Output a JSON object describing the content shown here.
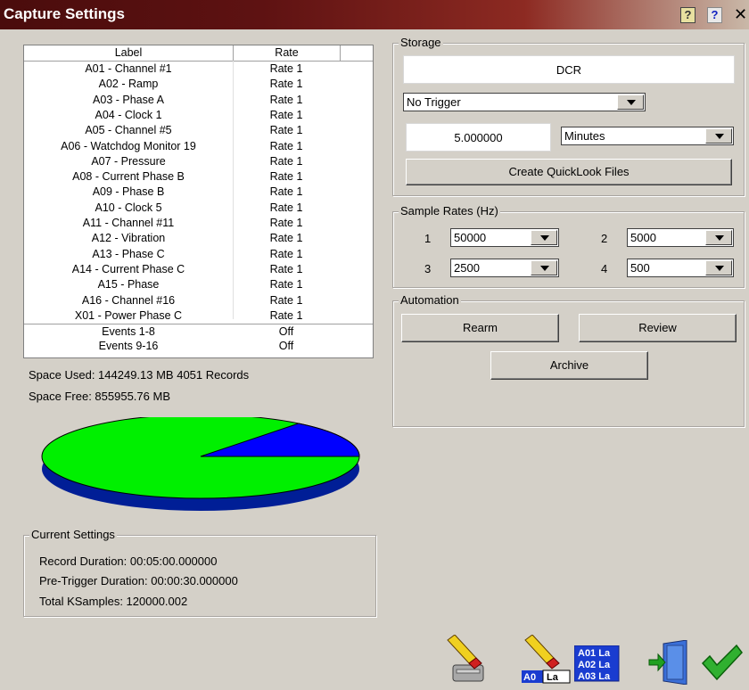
{
  "window": {
    "title": "Capture Settings",
    "help_label": "?",
    "close_label": "✕"
  },
  "channels": {
    "headers": [
      "Label",
      "Rate"
    ],
    "rows": [
      {
        "label": "A01 - Channel #1",
        "rate": "Rate 1"
      },
      {
        "label": "A02 - Ramp",
        "rate": "Rate 1"
      },
      {
        "label": "A03 - Phase A",
        "rate": "Rate 1"
      },
      {
        "label": "A04 - Clock 1",
        "rate": "Rate 1"
      },
      {
        "label": "A05 - Channel #5",
        "rate": "Rate 1"
      },
      {
        "label": "A06 - Watchdog Monitor 19",
        "rate": "Rate 1"
      },
      {
        "label": "A07 - Pressure",
        "rate": "Rate 1"
      },
      {
        "label": "A08 - Current Phase B",
        "rate": "Rate 1"
      },
      {
        "label": "A09 - Phase B",
        "rate": "Rate 1"
      },
      {
        "label": "A10 - Clock 5",
        "rate": "Rate 1"
      },
      {
        "label": "A11 - Channel #11",
        "rate": "Rate 1"
      },
      {
        "label": "A12 - Vibration",
        "rate": "Rate 1"
      },
      {
        "label": "A13 - Phase C",
        "rate": "Rate 1"
      },
      {
        "label": "A14 - Current Phase C",
        "rate": "Rate 1"
      },
      {
        "label": "A15 - Phase",
        "rate": "Rate 1"
      },
      {
        "label": "A16 - Channel #16",
        "rate": "Rate 1"
      },
      {
        "label": "X01 - Power Phase C",
        "rate": "Rate 1"
      },
      {
        "label": "Events 1-8",
        "rate": "Off"
      },
      {
        "label": "Events 9-16",
        "rate": "Off"
      }
    ]
  },
  "space": {
    "used": "Space Used: 144249.13 MB  4051 Records",
    "free": "Space Free: 855955.76 MB",
    "used_fraction": 0.1442,
    "used_color": "#0000ff",
    "free_color": "#00ff00"
  },
  "current_settings": {
    "title": "Current Settings",
    "record_duration": "Record Duration: 00:05:00.000000",
    "pretrigger_duration": "Pre-Trigger Duration: 00:00:30.000000",
    "total_ksamples": "Total KSamples: 120000.002"
  },
  "storage": {
    "title": "Storage",
    "mode": "DCR",
    "trigger": "No Trigger",
    "duration_value": "5.000000",
    "duration_unit": "Minutes",
    "quicklook_button": "Create QuickLook Files"
  },
  "sample_rates": {
    "title": "Sample Rates (Hz)",
    "rates": [
      {
        "num": "1",
        "value": "50000"
      },
      {
        "num": "2",
        "value": "5000"
      },
      {
        "num": "3",
        "value": "2500"
      },
      {
        "num": "4",
        "value": "500"
      }
    ]
  },
  "automation": {
    "title": "Automation",
    "rearm": "Rearm",
    "review": "Review",
    "archive": "Archive"
  },
  "footer": {
    "icons": [
      "erase-disk-icon",
      "erase-labels-icon",
      "channel-labels-icon",
      "exit-door-icon",
      "ok-check-icon"
    ],
    "labels_line1": "A01 La",
    "labels_line2": "A02 La",
    "labels_line3": "A03 La",
    "erase_label_tag1": "A0",
    "erase_label_tag2": "La"
  }
}
